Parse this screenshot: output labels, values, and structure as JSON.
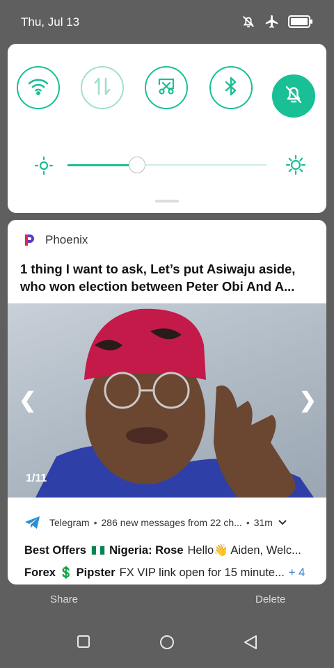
{
  "status_bar": {
    "date": "Thu, Jul 13",
    "icons": [
      "mute-notification-icon",
      "airplane-mode-icon",
      "battery-icon"
    ]
  },
  "quick_settings": {
    "accent_color": "#19bf95",
    "tiles": [
      {
        "name": "wifi",
        "icon": "wifi-icon",
        "state": "on"
      },
      {
        "name": "mobile-data",
        "icon": "data-transfer-icon",
        "state": "off"
      },
      {
        "name": "screenshot",
        "icon": "screenshot-icon",
        "state": "on"
      },
      {
        "name": "bluetooth",
        "icon": "bluetooth-icon",
        "state": "on"
      },
      {
        "name": "do-not-disturb",
        "icon": "bell-off-icon",
        "state": "active"
      }
    ],
    "brightness_fraction": 0.35
  },
  "notification": {
    "app_name": "Phoenix",
    "title_line1": "1 thing I want to ask, Let’s put Asiwaju aside,",
    "title_line2": "who won election between Peter Obi And A...",
    "image_counter": "1/11",
    "prev_arrow": "❮",
    "next_arrow": "❯"
  },
  "telegram": {
    "app_name": "Telegram",
    "summary": "286 new messages from 22 ch...",
    "time": "31m",
    "messages": [
      {
        "sender_before": "Best Offers",
        "sender_after": "Nigeria: Rose",
        "body": "Hello👋 Aiden, Welc..."
      },
      {
        "sender_before": "Forex",
        "sender_after": "Pipster",
        "body": "FX VIP link open for 15 minute...",
        "more": "+ 4"
      }
    ]
  },
  "background": {
    "share_label": "Share",
    "delete_label": "Delete"
  },
  "nav": {
    "buttons": [
      "recents-button",
      "home-button",
      "back-button"
    ]
  }
}
